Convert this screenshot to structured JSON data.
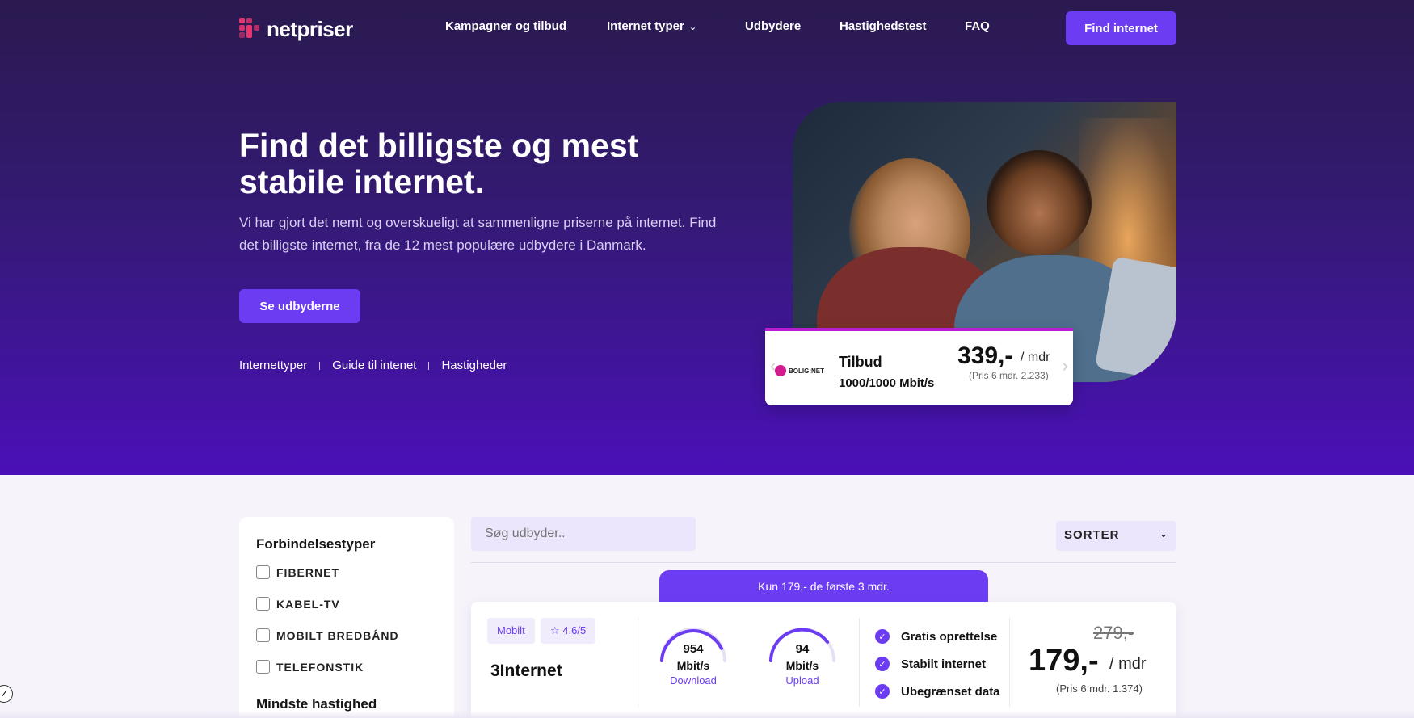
{
  "nav": {
    "logo_text": "netpriser",
    "items": [
      "Kampagner og tilbud",
      "Internet typer",
      "Udbydere",
      "Hastighedstest",
      "FAQ"
    ],
    "cta": "Find internet"
  },
  "hero": {
    "title": "Find det billigste og mest stabile internet.",
    "subtitle": "Vi har gjort det nemt og overskueligt at sammenligne priserne på internet. Find det billigste internet, fra de 12 mest populære udbydere i Danmark.",
    "button": "Se udbyderne",
    "links": [
      "Internettyper",
      "Guide til intenet",
      "Hastigheder"
    ]
  },
  "offer": {
    "logo_text": "BOLIG:NET",
    "title": "Tilbud",
    "speed": "1000/1000 Mbit/s",
    "price": "339,-",
    "unit": "/ mdr",
    "note": "(Pris 6 mdr. 2.233)"
  },
  "filters": {
    "title": "Forbindelsestyper",
    "options": [
      "FIBERNET",
      "KABEL-TV",
      "MOBILT BREDBÅND",
      "TELEFONSTIK"
    ],
    "speed_title": "Mindste hastighed"
  },
  "search": {
    "placeholder": "Søg udbyder.."
  },
  "sort": {
    "label": "SORTER"
  },
  "listing": {
    "promo": "Kun 179,- de første 3 mdr.",
    "type_tag": "Mobilt",
    "rating": "4.6/5",
    "provider": "3Internet",
    "download": {
      "value": "954",
      "unit": "Mbit/s",
      "label": "Download"
    },
    "upload": {
      "value": "94",
      "unit": "Mbit/s",
      "label": "Upload"
    },
    "features": [
      "Gratis oprettelse",
      "Stabilt internet",
      "Ubegrænset data"
    ],
    "old_price": "279,-",
    "price": "179,-",
    "unit": "/ mdr",
    "note": "(Pris 6 mdr. 1.374)"
  },
  "colors": {
    "accent": "#6b3cf2",
    "hero_top": "#2a1a4f",
    "hero_bottom": "#4a10b8",
    "brand_pink": "#e8346e"
  }
}
